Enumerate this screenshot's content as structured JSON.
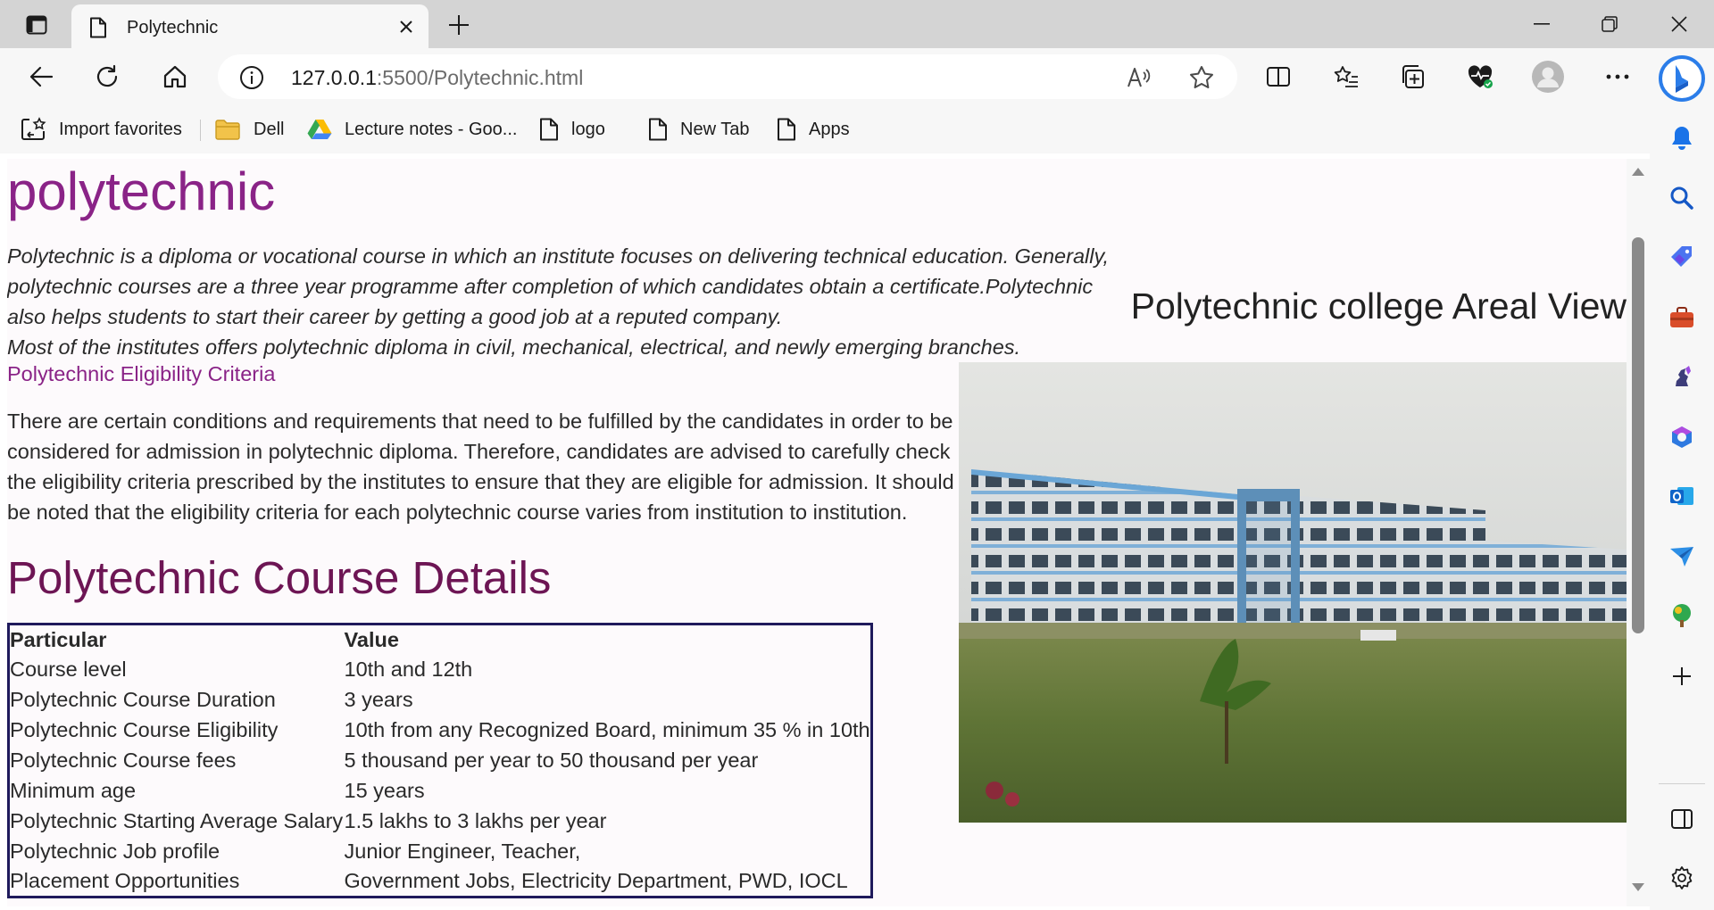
{
  "browser": {
    "tab_title": "Polytechnic",
    "url_host": "127.0.0.1",
    "url_rest": ":5500/Polytechnic.html",
    "favorites": [
      {
        "label": "Import favorites",
        "icon": "import-favorites-icon"
      },
      {
        "label": "Dell",
        "icon": "folder-icon"
      },
      {
        "label": "Lecture notes - Goo...",
        "icon": "google-drive-icon"
      },
      {
        "label": "logo",
        "icon": "page-icon"
      },
      {
        "label": "New Tab",
        "icon": "page-icon"
      },
      {
        "label": "Apps",
        "icon": "page-icon"
      }
    ]
  },
  "page": {
    "heading": "polytechnic",
    "intro_1": "Polytechnic is a diploma or vocational course in which an institute focuses on delivering technical education. Generally, polytechnic courses are a three year programme after completion of which candidates obtain a certificate.Polytechnic also helps students to start their career by getting a good job at a reputed company.",
    "intro_2": "Most of the institutes offers polytechnic diploma in civil, mechanical, electrical, and newly emerging branches.",
    "criteria_link": "Polytechnic Eligibility Criteria",
    "criteria_text": "There are certain conditions and requirements that need to be fulfilled by the candidates in order to be considered for admission in polytechnic diploma. Therefore, candidates are advised to carefully check the eligibility criteria prescribed by the institutes to ensure that they are eligible for admission. It should be noted that the eligibility criteria for each polytechnic course varies from institution to institution.",
    "course_heading": "Polytechnic Course Details",
    "aerial_caption": "Polytechnic college Areal View",
    "table": {
      "headers": [
        "Particular",
        "Value"
      ],
      "rows": [
        [
          "Course level",
          "10th and 12th"
        ],
        [
          "Polytechnic Course Duration",
          "3 years"
        ],
        [
          "Polytechnic Course Eligibility",
          "10th from any Recognized Board, minimum 35 % in 10th"
        ],
        [
          "Polytechnic Course fees",
          "5 thousand per year to 50 thousand per year"
        ],
        [
          "Minimum age",
          "15 years"
        ],
        [
          "Polytechnic Starting Average Salary",
          "1.5 lakhs to 3 lakhs per year"
        ],
        [
          "Polytechnic Job profile",
          "Junior Engineer, Teacher,"
        ],
        [
          "Placement Opportunities",
          "Government Jobs, Electricity Department, PWD, IOCL"
        ]
      ]
    }
  },
  "colors": {
    "heading": "#8a2387",
    "course_heading": "#6d1554",
    "table_border": "#1f1a5c"
  }
}
